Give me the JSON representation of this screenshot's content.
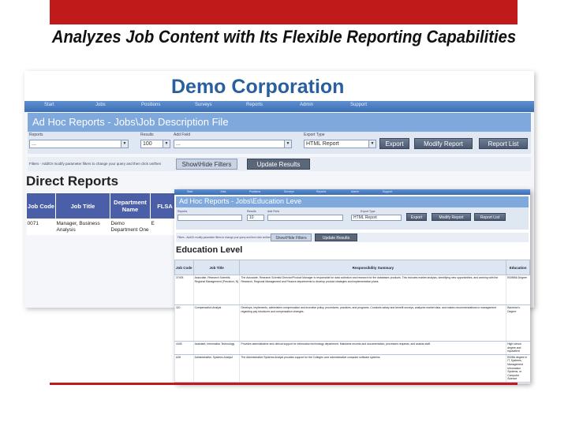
{
  "slide": {
    "title": "Analyzes Job Content with Its Flexible Reporting Capabilities"
  },
  "colors": {
    "accent": "#c01a1a",
    "brand": "#2a5f9e",
    "header": "#7fa8dc",
    "table_header": "#4a5fa8"
  },
  "shot1": {
    "logo": "Demo Corporation",
    "nav": [
      "Start",
      "Jobs",
      "Positions",
      "Surveys",
      "Reports",
      "Admin",
      "Support"
    ],
    "header": "Ad Hoc Reports - Jobs\\Job Description File",
    "filters": {
      "reports_label": "Reports",
      "reports_value": "...",
      "results_label": "Results",
      "results_value": "100",
      "add_field_label": "Add Field",
      "add_field_value": "...",
      "export_type_label": "Export Type",
      "export_type_value": "HTML Report"
    },
    "buttons": {
      "export": "Export",
      "modify": "Modify Report",
      "list": "Report List",
      "show_hide": "Show\\Hide Filters",
      "update": "Update Results"
    },
    "filter_note": "Filters - Add/Or modify parameter filters to change your query and then click on/then",
    "section_title": "Direct Reports",
    "table": {
      "headers": [
        "Job Code",
        "Job Title",
        "Department Name",
        "FLSA"
      ],
      "rows": [
        [
          "0071",
          "Manager, Business Analysis",
          "Demo Department One",
          "E"
        ]
      ]
    }
  },
  "shot2": {
    "nav": [
      "Start",
      "Jobs",
      "Positions",
      "Surveys",
      "Reports",
      "Admin",
      "Support"
    ],
    "header": "Ad Hoc Reports - Jobs\\Education Leve",
    "filters": {
      "reports_label": "Reports",
      "results_label": "Results",
      "add_field_label": "Add Field",
      "export_type_label": "Export Type",
      "results_value": "10",
      "export_type_value": "HTML Report"
    },
    "buttons": {
      "export": "Export",
      "modify": "Modify Report",
      "list": "Report List",
      "show_hide": "Show\\Hide Filters",
      "update": "Update Results"
    },
    "filter_note": "Filters - Add/Or modify parameter filters to change your query and then click on/then",
    "section_title": "Education Level",
    "table": {
      "headers": [
        "Job Code",
        "Job Title",
        "Responsibility Summary",
        "Education"
      ],
      "rows": [
        [
          "37405",
          "Associate, Research Scientist, Regional Management (Precision, N)",
          "The Associate, Research Scientist Director/Product Manager is responsible for data collection and research for the databases products. This includes market analysis, identifying new opportunities, and working with the Research, Regional Management and Finance departments to develop product strategies and implementation plans.",
          "BS/MBA Degree"
        ],
        [
          "110",
          "Compensation Analyst",
          "Develops, implements, administers compensation and incentive policy, procedures, practices, and programs. Conducts salary and benefit surveys, analyzes market data, and makes recommendations to management regarding pay structures and compensation changes.",
          "Bachelor's Degree"
        ],
        [
          "4445",
          "Assistant, Information Technology",
          "Provides administrative and clerical support for information technology department. Maintains records and documentation, processes requests, and assists staff.",
          "High school degree and equivalent"
        ],
        [
          "A26",
          "Administrative, Systems Analyst",
          "The Administrative Systems Analyst provides support for the Colleges core administrative computer software systems.",
          "BS/BA degree in IT, Systems, Management Information Systems, or Computer Science"
        ]
      ]
    }
  }
}
